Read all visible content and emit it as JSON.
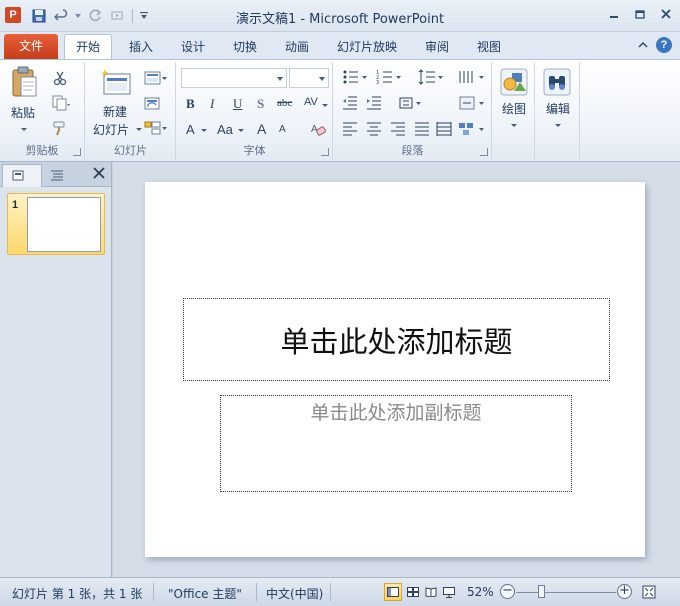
{
  "window": {
    "title": "演示文稿1 - Microsoft PowerPoint",
    "app_icon_letter": "P"
  },
  "tabs": {
    "file": "文件",
    "items": [
      "开始",
      "插入",
      "设计",
      "切换",
      "动画",
      "幻灯片放映",
      "审阅",
      "视图"
    ],
    "active_index": 0,
    "help_glyph": "?"
  },
  "ribbon": {
    "clipboard": {
      "label": "剪贴板",
      "paste": "粘贴"
    },
    "slides": {
      "label": "幻灯片",
      "new_slide_line1": "新建",
      "new_slide_line2": "幻灯片"
    },
    "font": {
      "label": "字体",
      "font_name": "",
      "font_size": "",
      "bold": "B",
      "italic": "I",
      "underline": "U",
      "shadow": "S",
      "strike": "abc",
      "spacing": "AV",
      "color_a": "A",
      "case": "Aa",
      "grow": "A",
      "shrink": "A"
    },
    "paragraph": {
      "label": "段落"
    },
    "drawing": {
      "label": "绘图"
    },
    "editing": {
      "label": "编辑"
    }
  },
  "left_panel": {
    "slide_number": "1"
  },
  "slide": {
    "title_placeholder": "单击此处添加标题",
    "subtitle_placeholder": "单击此处添加副标题"
  },
  "status_bar": {
    "slide_info": "幻灯片 第 1 张，共 1 张",
    "theme": "\"Office 主题\"",
    "language": "中文(中国)",
    "zoom": "52%",
    "zoom_minus": "−",
    "zoom_plus": "+"
  },
  "colors": {
    "file_tab": "#d24726",
    "accent_blue": "#3a76c4",
    "selected_thumb": "#ffd76b"
  }
}
